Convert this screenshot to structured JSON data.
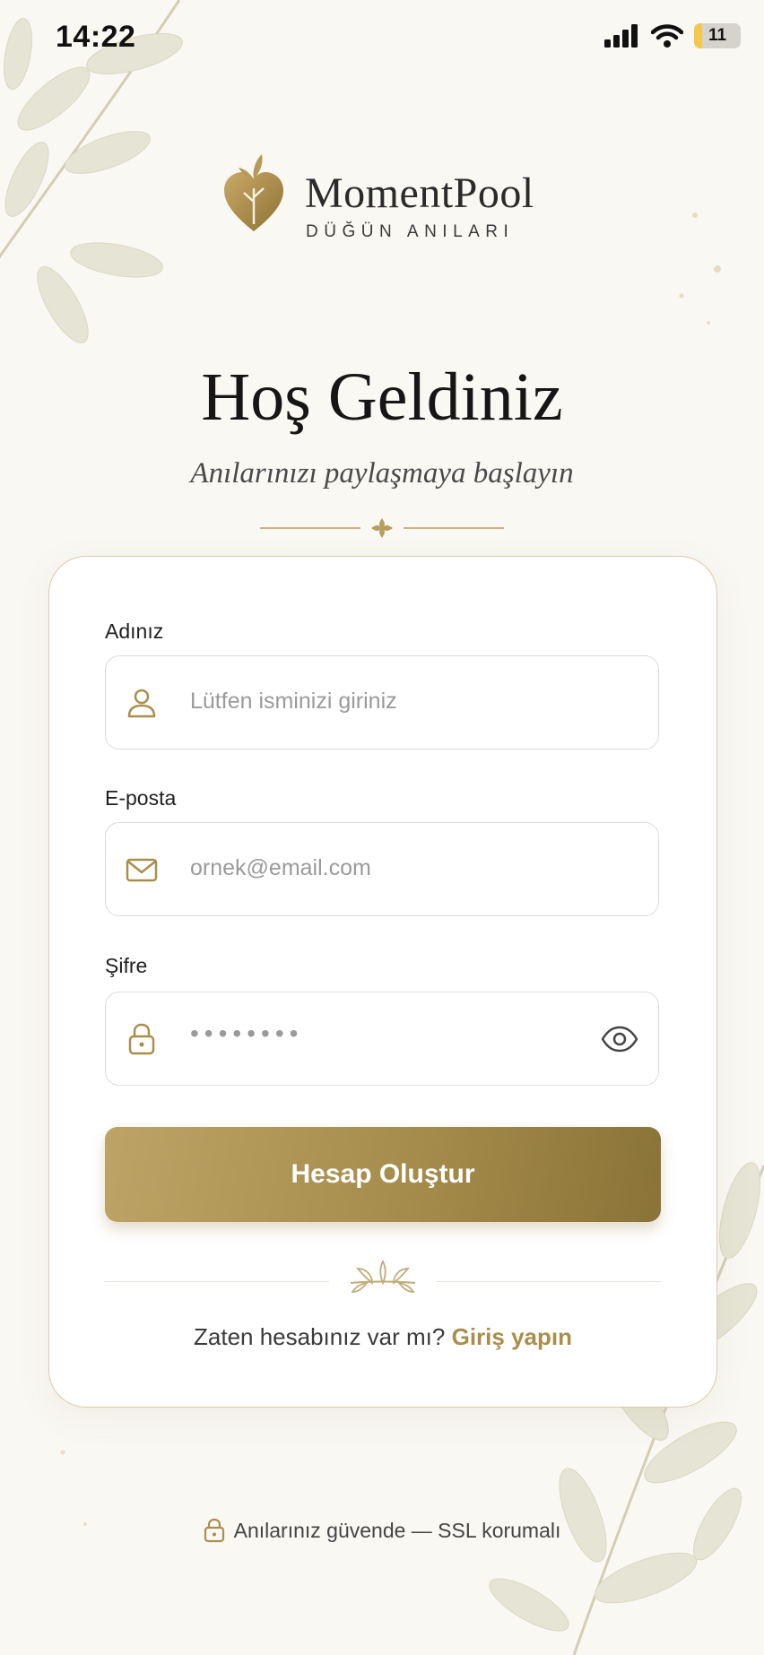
{
  "status_bar": {
    "time": "14:22",
    "battery": "11",
    "icons": [
      "signal-icon",
      "wifi-icon",
      "battery-icon"
    ]
  },
  "brand": {
    "name": "MomentPool",
    "tagline": "DÜĞÜN ANILARI",
    "accent_color": "#a88f4e"
  },
  "header": {
    "title": "Hoş Geldiniz",
    "subtitle": "Anılarınızı paylaşmaya başlayın"
  },
  "form": {
    "name": {
      "label": "Adınız",
      "placeholder": "Lütfen isminizi giriniz",
      "icon": "user-icon"
    },
    "email": {
      "label": "E-posta",
      "placeholder": "ornek@email.com",
      "icon": "mail-icon"
    },
    "password": {
      "label": "Şifre",
      "value": "••••••••",
      "icon": "lock-icon",
      "toggle_icon": "eye-icon"
    },
    "submit_label": "Hesap Oluştur"
  },
  "login_prompt": {
    "text": "Zaten hesabınız var mı?",
    "link": "Giriş yapın"
  },
  "footer": {
    "text": "Anılarınız güvende — SSL korumalı",
    "icon": "lock-icon"
  }
}
